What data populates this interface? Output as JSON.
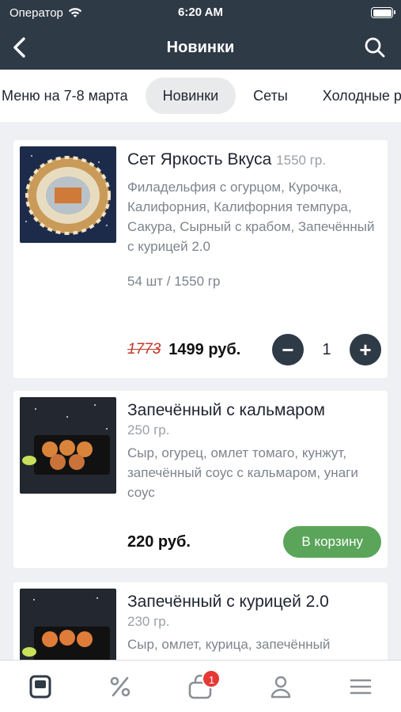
{
  "status_bar": {
    "carrier": "Оператор",
    "time": "6:20 AM"
  },
  "header": {
    "title": "Новинки"
  },
  "tabs": [
    {
      "label": "Меню на 7-8 марта",
      "active": false
    },
    {
      "label": "Новинки",
      "active": true
    },
    {
      "label": "Сеты",
      "active": false
    },
    {
      "label": "Холодные роллы",
      "active": false
    }
  ],
  "products": [
    {
      "name": "Сет Яркость Вкуса",
      "weight": "1550 гр.",
      "description": "Филадельфия с огурцом, Курочка, Калифорния, Калифорния темпура, Сакура, Сырный с крабом, Запечённый с курицей 2.0",
      "pieces": "54 шт / 1550 гр",
      "old_price": "1773",
      "price": "1499 руб.",
      "quantity": "1"
    },
    {
      "name": "Запечённый с кальмаром",
      "weight": "250 гр.",
      "description": "Сыр, огурец, омлет томаго, кунжут, запечённый соус с кальмаром, унаги соус",
      "price": "220 руб.",
      "cart_button": "В корзину"
    },
    {
      "name": "Запечённый с курицей 2.0",
      "weight": "230 гр.",
      "description": "Сыр, омлет, курица, запечённый"
    }
  ],
  "bottom_nav": {
    "items": [
      "menu-icon",
      "percent-icon",
      "bag-icon",
      "profile-icon",
      "hamburger-icon"
    ],
    "cart_badge": "1"
  },
  "colors": {
    "header_bg": "#2f3a47",
    "accent_green": "#5aa55a",
    "badge_red": "#e53935"
  }
}
